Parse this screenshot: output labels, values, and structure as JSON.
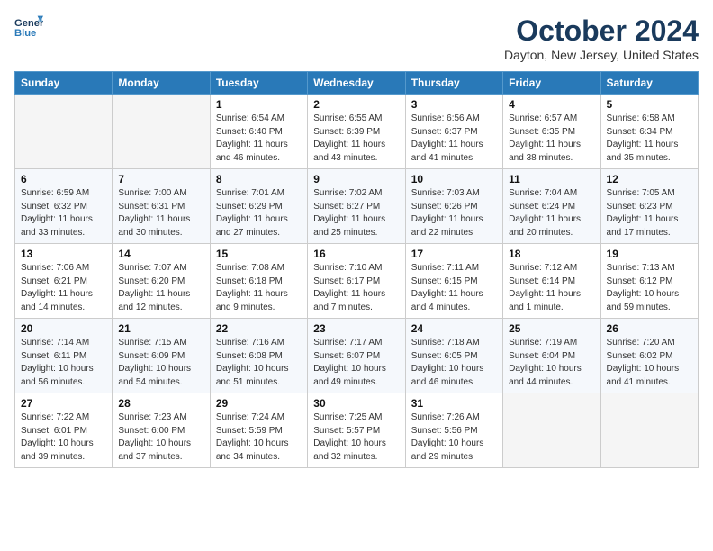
{
  "header": {
    "logo_line1": "General",
    "logo_line2": "Blue",
    "month": "October 2024",
    "location": "Dayton, New Jersey, United States"
  },
  "weekdays": [
    "Sunday",
    "Monday",
    "Tuesday",
    "Wednesday",
    "Thursday",
    "Friday",
    "Saturday"
  ],
  "weeks": [
    [
      {
        "day": null
      },
      {
        "day": null
      },
      {
        "day": "1",
        "sunrise": "Sunrise: 6:54 AM",
        "sunset": "Sunset: 6:40 PM",
        "daylight": "Daylight: 11 hours and 46 minutes."
      },
      {
        "day": "2",
        "sunrise": "Sunrise: 6:55 AM",
        "sunset": "Sunset: 6:39 PM",
        "daylight": "Daylight: 11 hours and 43 minutes."
      },
      {
        "day": "3",
        "sunrise": "Sunrise: 6:56 AM",
        "sunset": "Sunset: 6:37 PM",
        "daylight": "Daylight: 11 hours and 41 minutes."
      },
      {
        "day": "4",
        "sunrise": "Sunrise: 6:57 AM",
        "sunset": "Sunset: 6:35 PM",
        "daylight": "Daylight: 11 hours and 38 minutes."
      },
      {
        "day": "5",
        "sunrise": "Sunrise: 6:58 AM",
        "sunset": "Sunset: 6:34 PM",
        "daylight": "Daylight: 11 hours and 35 minutes."
      }
    ],
    [
      {
        "day": "6",
        "sunrise": "Sunrise: 6:59 AM",
        "sunset": "Sunset: 6:32 PM",
        "daylight": "Daylight: 11 hours and 33 minutes."
      },
      {
        "day": "7",
        "sunrise": "Sunrise: 7:00 AM",
        "sunset": "Sunset: 6:31 PM",
        "daylight": "Daylight: 11 hours and 30 minutes."
      },
      {
        "day": "8",
        "sunrise": "Sunrise: 7:01 AM",
        "sunset": "Sunset: 6:29 PM",
        "daylight": "Daylight: 11 hours and 27 minutes."
      },
      {
        "day": "9",
        "sunrise": "Sunrise: 7:02 AM",
        "sunset": "Sunset: 6:27 PM",
        "daylight": "Daylight: 11 hours and 25 minutes."
      },
      {
        "day": "10",
        "sunrise": "Sunrise: 7:03 AM",
        "sunset": "Sunset: 6:26 PM",
        "daylight": "Daylight: 11 hours and 22 minutes."
      },
      {
        "day": "11",
        "sunrise": "Sunrise: 7:04 AM",
        "sunset": "Sunset: 6:24 PM",
        "daylight": "Daylight: 11 hours and 20 minutes."
      },
      {
        "day": "12",
        "sunrise": "Sunrise: 7:05 AM",
        "sunset": "Sunset: 6:23 PM",
        "daylight": "Daylight: 11 hours and 17 minutes."
      }
    ],
    [
      {
        "day": "13",
        "sunrise": "Sunrise: 7:06 AM",
        "sunset": "Sunset: 6:21 PM",
        "daylight": "Daylight: 11 hours and 14 minutes."
      },
      {
        "day": "14",
        "sunrise": "Sunrise: 7:07 AM",
        "sunset": "Sunset: 6:20 PM",
        "daylight": "Daylight: 11 hours and 12 minutes."
      },
      {
        "day": "15",
        "sunrise": "Sunrise: 7:08 AM",
        "sunset": "Sunset: 6:18 PM",
        "daylight": "Daylight: 11 hours and 9 minutes."
      },
      {
        "day": "16",
        "sunrise": "Sunrise: 7:10 AM",
        "sunset": "Sunset: 6:17 PM",
        "daylight": "Daylight: 11 hours and 7 minutes."
      },
      {
        "day": "17",
        "sunrise": "Sunrise: 7:11 AM",
        "sunset": "Sunset: 6:15 PM",
        "daylight": "Daylight: 11 hours and 4 minutes."
      },
      {
        "day": "18",
        "sunrise": "Sunrise: 7:12 AM",
        "sunset": "Sunset: 6:14 PM",
        "daylight": "Daylight: 11 hours and 1 minute."
      },
      {
        "day": "19",
        "sunrise": "Sunrise: 7:13 AM",
        "sunset": "Sunset: 6:12 PM",
        "daylight": "Daylight: 10 hours and 59 minutes."
      }
    ],
    [
      {
        "day": "20",
        "sunrise": "Sunrise: 7:14 AM",
        "sunset": "Sunset: 6:11 PM",
        "daylight": "Daylight: 10 hours and 56 minutes."
      },
      {
        "day": "21",
        "sunrise": "Sunrise: 7:15 AM",
        "sunset": "Sunset: 6:09 PM",
        "daylight": "Daylight: 10 hours and 54 minutes."
      },
      {
        "day": "22",
        "sunrise": "Sunrise: 7:16 AM",
        "sunset": "Sunset: 6:08 PM",
        "daylight": "Daylight: 10 hours and 51 minutes."
      },
      {
        "day": "23",
        "sunrise": "Sunrise: 7:17 AM",
        "sunset": "Sunset: 6:07 PM",
        "daylight": "Daylight: 10 hours and 49 minutes."
      },
      {
        "day": "24",
        "sunrise": "Sunrise: 7:18 AM",
        "sunset": "Sunset: 6:05 PM",
        "daylight": "Daylight: 10 hours and 46 minutes."
      },
      {
        "day": "25",
        "sunrise": "Sunrise: 7:19 AM",
        "sunset": "Sunset: 6:04 PM",
        "daylight": "Daylight: 10 hours and 44 minutes."
      },
      {
        "day": "26",
        "sunrise": "Sunrise: 7:20 AM",
        "sunset": "Sunset: 6:02 PM",
        "daylight": "Daylight: 10 hours and 41 minutes."
      }
    ],
    [
      {
        "day": "27",
        "sunrise": "Sunrise: 7:22 AM",
        "sunset": "Sunset: 6:01 PM",
        "daylight": "Daylight: 10 hours and 39 minutes."
      },
      {
        "day": "28",
        "sunrise": "Sunrise: 7:23 AM",
        "sunset": "Sunset: 6:00 PM",
        "daylight": "Daylight: 10 hours and 37 minutes."
      },
      {
        "day": "29",
        "sunrise": "Sunrise: 7:24 AM",
        "sunset": "Sunset: 5:59 PM",
        "daylight": "Daylight: 10 hours and 34 minutes."
      },
      {
        "day": "30",
        "sunrise": "Sunrise: 7:25 AM",
        "sunset": "Sunset: 5:57 PM",
        "daylight": "Daylight: 10 hours and 32 minutes."
      },
      {
        "day": "31",
        "sunrise": "Sunrise: 7:26 AM",
        "sunset": "Sunset: 5:56 PM",
        "daylight": "Daylight: 10 hours and 29 minutes."
      },
      {
        "day": null
      },
      {
        "day": null
      }
    ]
  ]
}
